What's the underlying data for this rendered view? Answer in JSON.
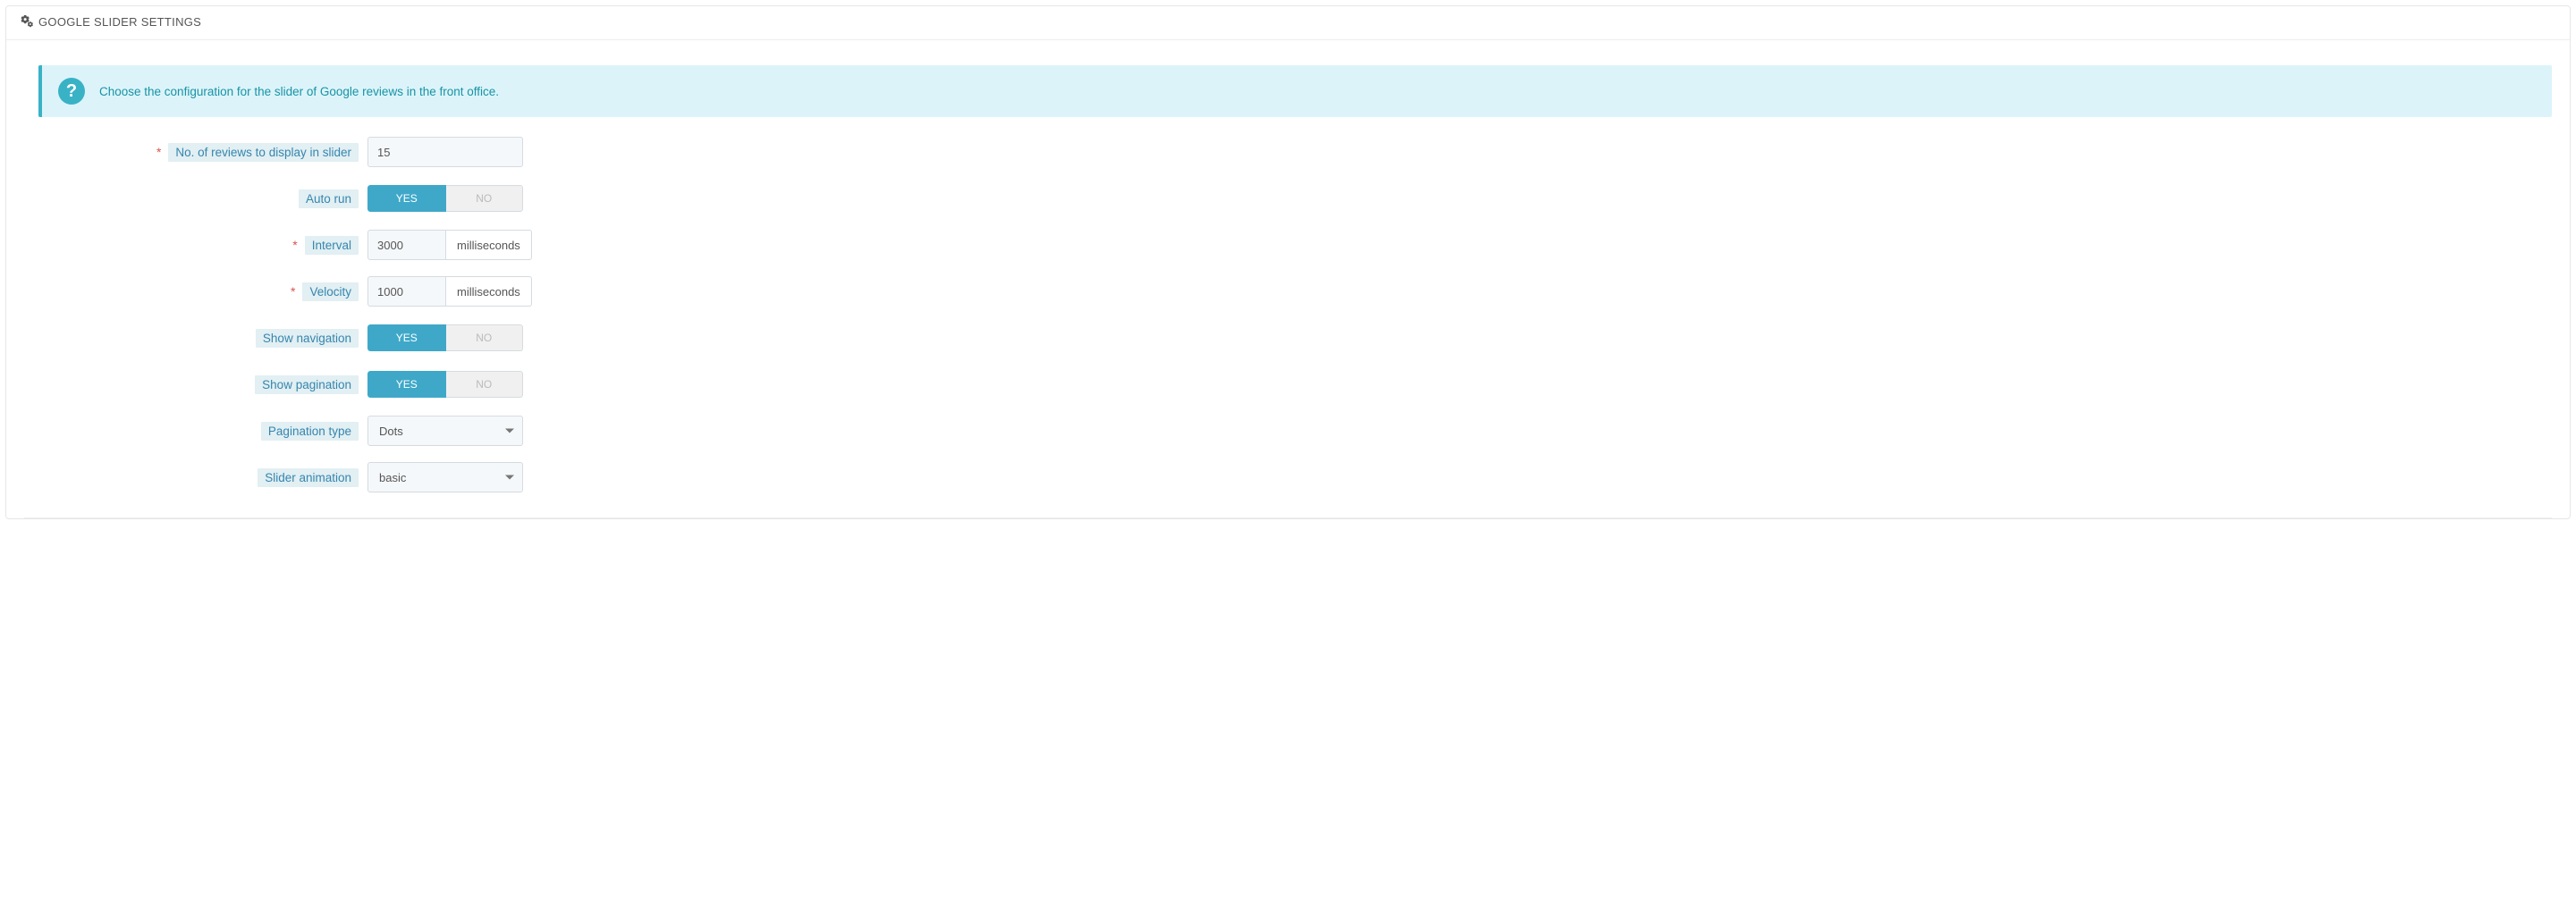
{
  "panel": {
    "title": "Google Slider Settings"
  },
  "alert": {
    "message": "Choose the configuration for the slider of Google reviews in the front office."
  },
  "toggle_labels": {
    "yes": "YES",
    "no": "NO"
  },
  "units": {
    "ms": "milliseconds"
  },
  "fields": {
    "reviews_count": {
      "label": "No. of reviews to display in slider",
      "value": "15",
      "required": true
    },
    "auto_run": {
      "label": "Auto run",
      "value": "yes"
    },
    "interval": {
      "label": "Interval",
      "value": "3000",
      "required": true
    },
    "velocity": {
      "label": "Velocity",
      "value": "1000",
      "required": true
    },
    "show_nav": {
      "label": "Show navigation",
      "value": "yes"
    },
    "show_pag": {
      "label": "Show pagination",
      "value": "yes"
    },
    "pag_type": {
      "label": "Pagination type",
      "value": "Dots",
      "options": [
        "Dots"
      ]
    },
    "animation": {
      "label": "Slider animation",
      "value": "basic",
      "options": [
        "basic"
      ]
    }
  }
}
